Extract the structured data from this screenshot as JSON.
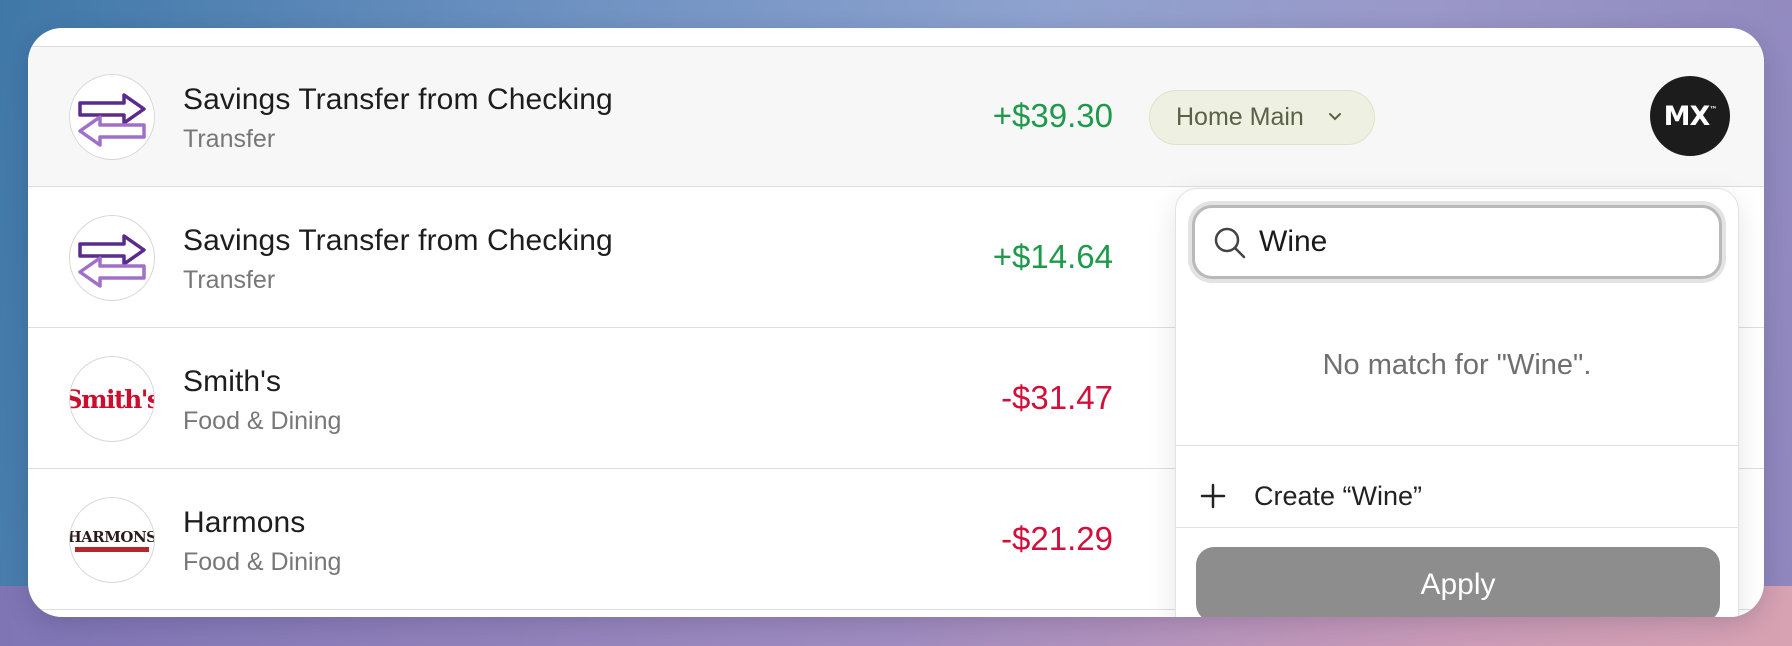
{
  "transactions": [
    {
      "name": "Savings Transfer from Checking",
      "category": "Transfer",
      "amount": "+$39.30",
      "logo": "transfer-arrows-icon"
    },
    {
      "name": "Savings Transfer from Checking",
      "category": "Transfer",
      "amount": "+$14.64",
      "logo": "transfer-arrows-icon"
    },
    {
      "name": "Smith's",
      "category": "Food & Dining",
      "amount": "-$31.47",
      "logo_text": "Smith's"
    },
    {
      "name": "Harmons",
      "category": "Food & Dining",
      "amount": "-$21.29",
      "logo_text": "HARMONS"
    }
  ],
  "account_selector": {
    "label": "Home Main",
    "icon": "chevron-down-icon"
  },
  "avatar": {
    "text": "MX",
    "mark": "™"
  },
  "dropdown": {
    "search_value": "Wine",
    "search_icon": "search-icon",
    "no_match_text": "No match for \"Wine\".",
    "create_label": "Create “Wine”",
    "apply_label": "Apply"
  },
  "colors": {
    "positive": "#1e9a4b",
    "negative": "#d0103a",
    "apply_bg": "#8d8d8d",
    "pill_bg": "#eef0e2"
  }
}
